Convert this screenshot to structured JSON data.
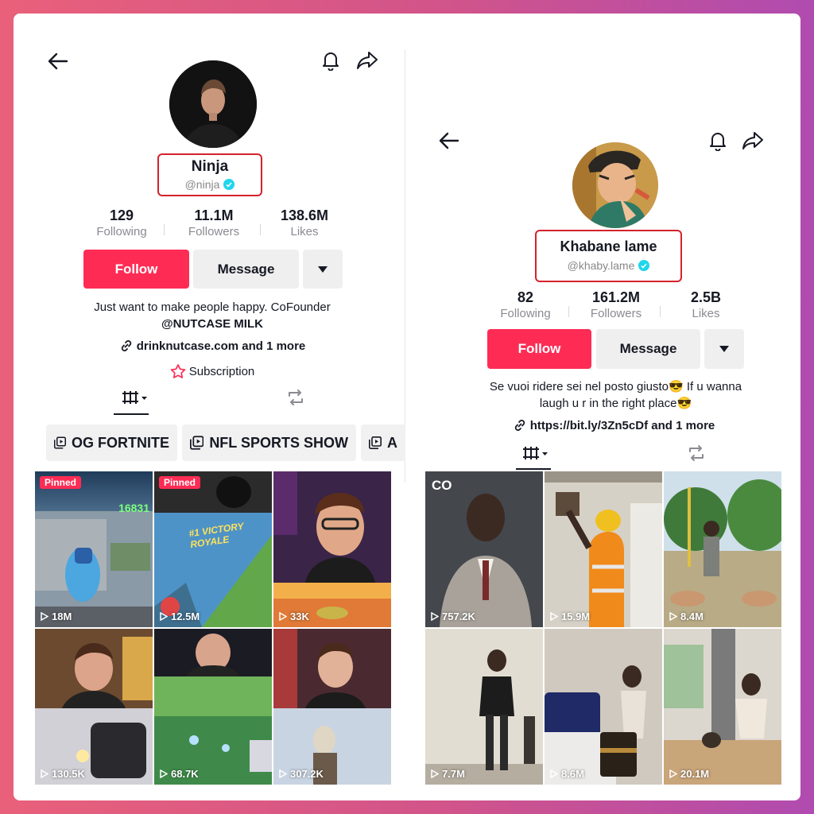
{
  "left": {
    "name": "Ninja",
    "handle": "@ninja",
    "stats": [
      {
        "value": "129",
        "label": "Following"
      },
      {
        "value": "11.1M",
        "label": "Followers"
      },
      {
        "value": "138.6M",
        "label": "Likes"
      }
    ],
    "follow_label": "Follow",
    "message_label": "Message",
    "bio_line1": "Just want to make people happy. CoFounder",
    "bio_line2": "@NUTCASE MILK",
    "link_text": "drinknutcase.com and 1 more",
    "subscription_label": "Subscription",
    "chips": [
      "OG FORTNITE",
      "NFL SPORTS SHOW",
      "A"
    ],
    "videos": [
      {
        "views": "18M",
        "pinned": "Pinned",
        "overlay": "16831"
      },
      {
        "views": "12.5M",
        "pinned": "Pinned",
        "overlay": "#1 VICTORY ROYALE"
      },
      {
        "views": "33K"
      },
      {
        "views": "130.5K"
      },
      {
        "views": "68.7K"
      },
      {
        "views": "307.2K"
      }
    ]
  },
  "right": {
    "name": "Khabane lame",
    "handle": "@khaby.lame",
    "stats": [
      {
        "value": "82",
        "label": "Following"
      },
      {
        "value": "161.2M",
        "label": "Followers"
      },
      {
        "value": "2.5B",
        "label": "Likes"
      }
    ],
    "follow_label": "Follow",
    "message_label": "Message",
    "bio_line1": "Se vuoi ridere sei nel posto giusto😎 If u wanna",
    "bio_line2": "laugh u r in the right place😎",
    "link_text": "https://bit.ly/3Zn5cDf and 1 more",
    "videos": [
      {
        "views": "757.2K",
        "badge": "CO"
      },
      {
        "views": "15.9M"
      },
      {
        "views": "8.4M"
      },
      {
        "views": "7.7M"
      },
      {
        "views": "8.6M"
      },
      {
        "views": "20.1M"
      }
    ]
  },
  "colors": {
    "accent": "#fe2c55",
    "highlight_box": "#d4222b",
    "verified": "#20d5ec"
  }
}
